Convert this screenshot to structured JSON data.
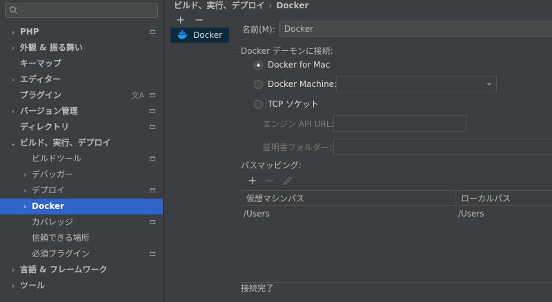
{
  "search": {
    "placeholder": ""
  },
  "sidebar": {
    "items": [
      {
        "label": "PHP",
        "arrow": "›",
        "indent": 0,
        "bold": true,
        "proj": true
      },
      {
        "label": "外観 & 振る舞い",
        "arrow": "›",
        "indent": 0,
        "bold": true,
        "proj": false
      },
      {
        "label": "キーマップ",
        "arrow": "",
        "indent": 0,
        "bold": true,
        "proj": false
      },
      {
        "label": "エディター",
        "arrow": "›",
        "indent": 0,
        "bold": true,
        "proj": false
      },
      {
        "label": "プラグイン",
        "arrow": "",
        "indent": 0,
        "bold": true,
        "proj": true,
        "transl": true
      },
      {
        "label": "バージョン管理",
        "arrow": "›",
        "indent": 0,
        "bold": true,
        "proj": true
      },
      {
        "label": "ディレクトリ",
        "arrow": "",
        "indent": 0,
        "bold": true,
        "proj": true
      },
      {
        "label": "ビルド、実行、デプロイ",
        "arrow": "⌄",
        "indent": 0,
        "bold": true,
        "proj": false
      },
      {
        "label": "ビルドツール",
        "arrow": "",
        "indent": 1,
        "bold": false,
        "proj": true
      },
      {
        "label": "デバッガー",
        "arrow": "›",
        "indent": 1,
        "bold": false,
        "proj": false
      },
      {
        "label": "デプロイ",
        "arrow": "›",
        "indent": 1,
        "bold": false,
        "proj": true
      },
      {
        "label": "Docker",
        "arrow": "›",
        "indent": 1,
        "bold": true,
        "proj": false,
        "selected": true
      },
      {
        "label": "カバレッジ",
        "arrow": "",
        "indent": 1,
        "bold": false,
        "proj": true
      },
      {
        "label": "信頼できる場所",
        "arrow": "",
        "indent": 1,
        "bold": false,
        "proj": false
      },
      {
        "label": "必須プラグイン",
        "arrow": "",
        "indent": 1,
        "bold": false,
        "proj": true
      },
      {
        "label": "言語 & フレームワーク",
        "arrow": "›",
        "indent": 0,
        "bold": true,
        "proj": false
      },
      {
        "label": "ツール",
        "arrow": "›",
        "indent": 0,
        "bold": true,
        "proj": false
      }
    ]
  },
  "breadcrumb": {
    "parent": "ビルド、実行、デプロイ",
    "separator": "›",
    "current": "Docker"
  },
  "list_toolbar": {
    "add": "+",
    "remove": "−"
  },
  "servers": [
    {
      "name": "Docker"
    }
  ],
  "form": {
    "name_label": "名前(M):",
    "name_value": "Docker",
    "connect_label": "Docker デーモンに接続:",
    "opt_mac": "Docker for Mac",
    "opt_machine": "Docker Machine:",
    "opt_tcp": "TCP ソケット",
    "engine_url_label": "エンジン API URL:",
    "cert_label": "証明書フォルダー:",
    "path_mapping_label": "パスマッピング:",
    "pm_add": "+",
    "pm_remove": "−",
    "col_virtual": "仮想マシンパス",
    "col_local": "ローカルパス",
    "row_virtual": "/Users",
    "row_local": "/Users",
    "status": "接続完了"
  },
  "colors": {
    "selection": "#2f65ca",
    "list_selection": "#0d293e",
    "docker_blue": "#2496ed"
  }
}
